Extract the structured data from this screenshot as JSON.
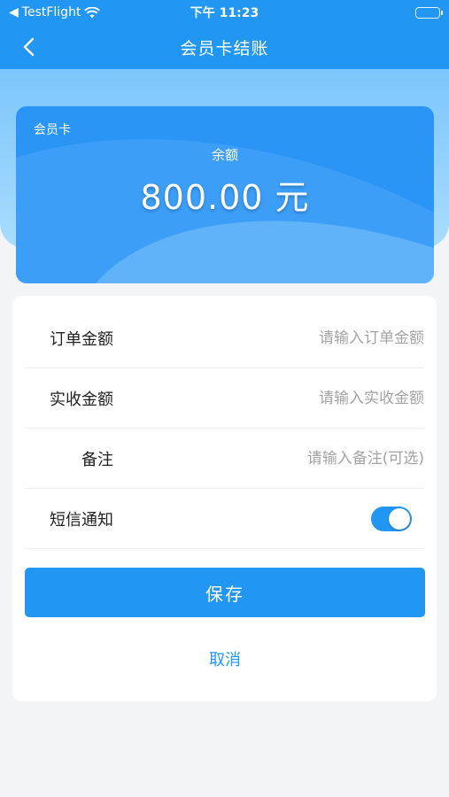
{
  "status_bar": {
    "carrier": "TestFlight",
    "time": "下午 11:23"
  },
  "nav": {
    "title": "会员卡结账",
    "back_icon": "chevron-left-icon"
  },
  "card": {
    "label": "会员卡",
    "balance_label": "余额",
    "balance": "800.00 元"
  },
  "form": {
    "order_amount": {
      "label": "订单金额",
      "value": "",
      "placeholder": "请输入订单金额"
    },
    "received_amount": {
      "label": "实收金额",
      "value": "",
      "placeholder": "请输入实收金额"
    },
    "remark": {
      "label": "备注",
      "value": "",
      "placeholder": "请输入备注(可选)"
    },
    "sms_notify": {
      "label": "短信通知",
      "enabled": true
    }
  },
  "actions": {
    "save_label": "保存",
    "cancel_label": "取消"
  },
  "colors": {
    "primary": "#2196f3",
    "header_light": "#a9dcff",
    "page_bg": "#f3f4f6"
  }
}
